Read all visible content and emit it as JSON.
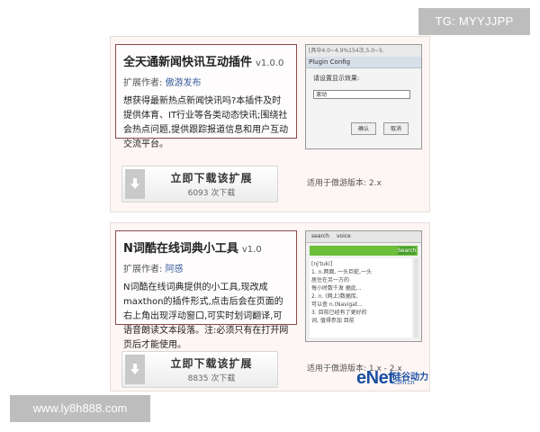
{
  "watermarks": {
    "top": "TG: MYYJJPP",
    "bottom": "www.ly8h888.com"
  },
  "plugins": [
    {
      "title": "全天通新闻快讯互动插件",
      "version": "v1.0.0",
      "author_label": "扩展作者:",
      "author": "傲游发布",
      "description": "想获得最新热点新闻快讯吗?本插件及时提供体育、IT行业等各类动态快讯;围绕社会热点问题,提供跟踪报道信息和用户互动交流平台。",
      "download_label": "立即下载该扩展",
      "download_count": "6093 次下载",
      "applies": "适用于傲游版本: 2.x",
      "screenshot": {
        "top_text": "[具中4.0~4.9%154次,5.0~5.",
        "window_title": "Plugin Config",
        "label": "请设置显示效果:",
        "select_value": "滚动",
        "ok": "确认",
        "cancel": "取消"
      }
    },
    {
      "title": "N词酷在线词典小工具",
      "version": "v1.0",
      "author_label": "扩展作者:",
      "author": "阿感",
      "description": "N词酷在线词典提供的小工具,现改成maxthon的插件形式,点击后会在页面的右上角出现浮动窗口,可实时划词翻译,可语音朗读文本段落。注:必须只有在打开网页后才能使用。",
      "download_label": "立即下载该扩展",
      "download_count": "8835 次下载",
      "applies": "适用于傲游版本: 1.x - 2.x",
      "screenshot": {
        "tab_search": "search",
        "tab_voice": "voice",
        "search_btn": "Search",
        "content": "[nj'tuki] 1. n.两面... 一头巨蛇,一头在另一头或... 每小时数千发的... 2. n. 数据...",
        "lines": [
          "[nj'tuki]",
          "1. n.两面, 一头巨蛇,一头",
          "居住在另一方的",
          "每小时数千发 据此...",
          "2. n. (网上)数据库,",
          "可以查 n.(Navigat...",
          "3. 目前已经有了更好的",
          "词, 值得参加 目前"
        ]
      }
    }
  ],
  "brand": {
    "logo": "eNet",
    "cn": "硅谷动力",
    "domain": ".com.cn"
  }
}
